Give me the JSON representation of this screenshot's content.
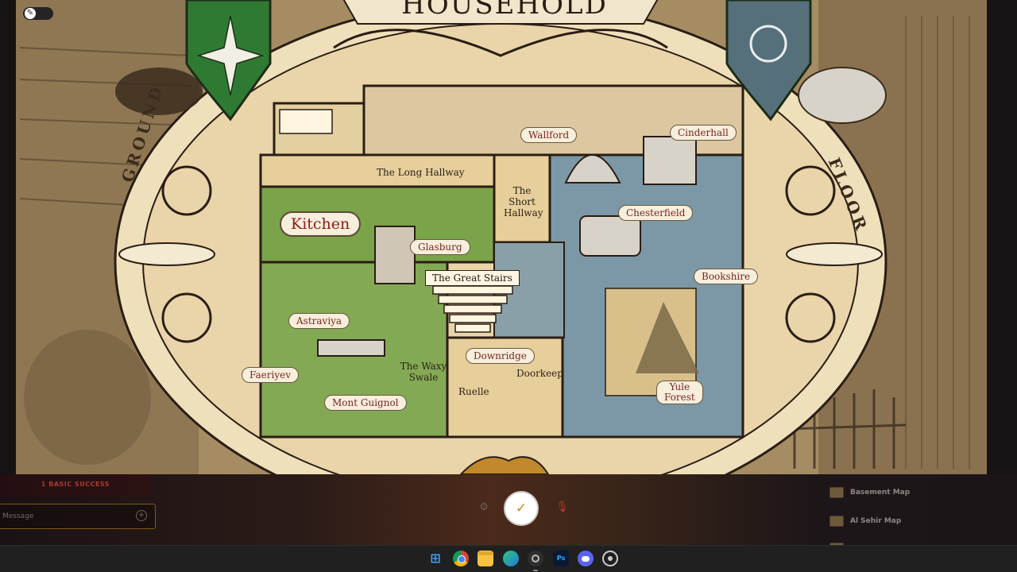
{
  "map": {
    "title": "HOUSEHOLD",
    "side_left": "GROUND",
    "side_right": "FLOOR",
    "labels": {
      "wallford": "Wallford",
      "cinderhall": "Cinderhall",
      "long_hallway": "The Long Hallway",
      "short_hallway_1": "The",
      "short_hallway_2": "Short",
      "short_hallway_3": "Hallway",
      "kitchen": "Kitchen",
      "glasburg": "Glasburg",
      "chesterfield": "Chesterfield",
      "great_stairs": "The Great Stairs",
      "bookshire": "Bookshire",
      "astraviya": "Astraviya",
      "downridge": "Downridge",
      "doorkeep": "Doorkeep",
      "waxy_swale_1": "The Waxy",
      "waxy_swale_2": "Swale",
      "faeriyev": "Faeriyev",
      "ruelle": "Ruelle",
      "mont_guignol": "Mont Guignol",
      "yule_forest_1": "Yule",
      "yule_forest_2": "Forest"
    },
    "colors": {
      "parchment": "#e9d5a9",
      "kitchen_green": "#7aa34a",
      "living_blue": "#7c98a6",
      "hallway_tan": "#dcc28c",
      "ink": "#2a1d14",
      "label_red": "#7a2620",
      "crest_green": "#2f7a32",
      "crest_slate": "#55707a"
    }
  },
  "viewer": {
    "tool_icon": "pen-icon"
  },
  "panel": {
    "roll_result": "1 BASIC SUCCESS",
    "message_placeholder": "Message",
    "confirm_icon": "check-icon",
    "settings_icon": "gear-icon",
    "mic_icon": "mic-muted-icon",
    "maps": [
      {
        "name": "Basement Map"
      },
      {
        "name": "Al Sehir Map"
      },
      {
        "name": ""
      }
    ]
  },
  "taskbar": {
    "apps": [
      {
        "name": "start-icon",
        "glyph": "⊞"
      },
      {
        "name": "chrome-icon",
        "glyph": ""
      },
      {
        "name": "file-explorer-icon",
        "glyph": ""
      },
      {
        "name": "edge-icon",
        "glyph": ""
      },
      {
        "name": "app-icon",
        "glyph": ""
      },
      {
        "name": "photoshop-icon",
        "glyph": "Ps"
      },
      {
        "name": "discord-icon",
        "glyph": ""
      },
      {
        "name": "steam-icon",
        "glyph": ""
      }
    ]
  }
}
